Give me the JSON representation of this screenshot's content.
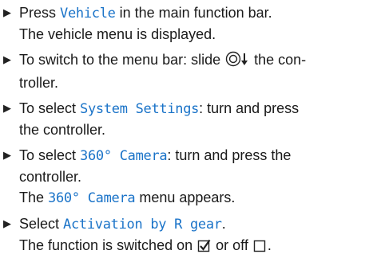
{
  "steps": [
    {
      "pre": "Press ",
      "highlight": "Vehicle",
      "post": " in the main function bar.",
      "result": "The vehicle menu is displayed."
    },
    {
      "pre": "To switch to the menu bar: slide ",
      "post_icon": " the con-",
      "continuation": "troller.",
      "icon": "controller-slide-down-icon"
    },
    {
      "pre": "To select ",
      "highlight": "System Settings",
      "post": ": turn and press",
      "continuation": "the controller."
    },
    {
      "pre": "To select ",
      "highlight": "360° Camera",
      "post": ": turn and press the",
      "continuation": "controller.",
      "result_highlight": "360° Camera",
      "result_post": " menu appears.",
      "result_pre": "The "
    },
    {
      "pre": "Select ",
      "highlight": "Activation by R gear",
      "post": ".",
      "result_pre": "The function is switched on ",
      "result_mid": " or off ",
      "result_end": ".",
      "icons": [
        "checkbox-checked-icon",
        "checkbox-empty-icon"
      ]
    }
  ],
  "colors": {
    "highlight": "#1a73c8"
  }
}
